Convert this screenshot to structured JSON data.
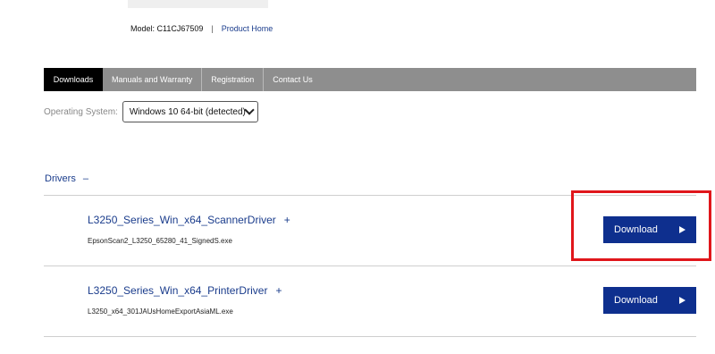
{
  "product": {
    "model_label": "Model: C11CJ67509",
    "separator": "|",
    "product_home_link": "Product Home"
  },
  "tabs": [
    {
      "label": "Downloads",
      "active": true
    },
    {
      "label": "Manuals and Warranty",
      "active": false
    },
    {
      "label": "Registration",
      "active": false
    },
    {
      "label": "Contact Us",
      "active": false
    }
  ],
  "os_selector": {
    "label": "Operating System:",
    "selected": "Windows 10 64-bit (detected)"
  },
  "drivers_section": {
    "title": "Drivers",
    "toggle_symbol": "–",
    "items": [
      {
        "title": "L3250_Series_Win_x64_ScannerDriver",
        "expand_symbol": "+",
        "filename": "EpsonScan2_L3250_65280_41_SignedS.exe",
        "button_label": "Download"
      },
      {
        "title": "L3250_Series_Win_x64_PrinterDriver",
        "expand_symbol": "+",
        "filename": "L3250_x64_301JAUsHomeExportAsiaML.exe",
        "button_label": "Download"
      }
    ]
  },
  "colors": {
    "link_blue": "#1a3c8c",
    "button_blue": "#0e2f8e",
    "tab_bar": "#8e8e8e",
    "active_tab": "#000000",
    "highlight_red": "#e0161b"
  }
}
